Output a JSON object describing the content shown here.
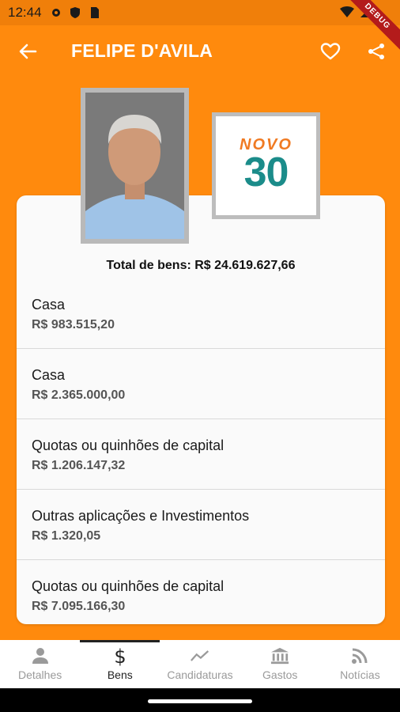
{
  "status_bar": {
    "time": "12:44"
  },
  "debug_banner": "DEBUG",
  "app_bar": {
    "title": "FELIPE D'AVILA"
  },
  "party_logo": {
    "text_top": "NOVO",
    "text_number": "30"
  },
  "assets": {
    "total_label": "Total de bens: R$ 24.619.627,66",
    "items": [
      {
        "title": "Casa",
        "value": "R$ 983.515,20"
      },
      {
        "title": "Casa",
        "value": "R$ 2.365.000,00"
      },
      {
        "title": "Quotas ou quinhões de capital",
        "value": "R$ 1.206.147,32"
      },
      {
        "title": "Outras aplicações e Investimentos",
        "value": "R$ 1.320,05"
      },
      {
        "title": "Quotas ou quinhões de capital",
        "value": "R$ 7.095.166,30"
      }
    ]
  },
  "bottom_nav": {
    "items": [
      {
        "label": "Detalhes",
        "icon": "person-icon"
      },
      {
        "label": "Bens",
        "icon": "dollar-icon",
        "active": true
      },
      {
        "label": "Candidaturas",
        "icon": "trending-icon"
      },
      {
        "label": "Gastos",
        "icon": "bank-icon"
      },
      {
        "label": "Notícias",
        "icon": "rss-icon"
      }
    ]
  },
  "colors": {
    "primary": "#FF8A0D",
    "teal": "#1B8C8A",
    "logo_orange": "#F07A22"
  }
}
